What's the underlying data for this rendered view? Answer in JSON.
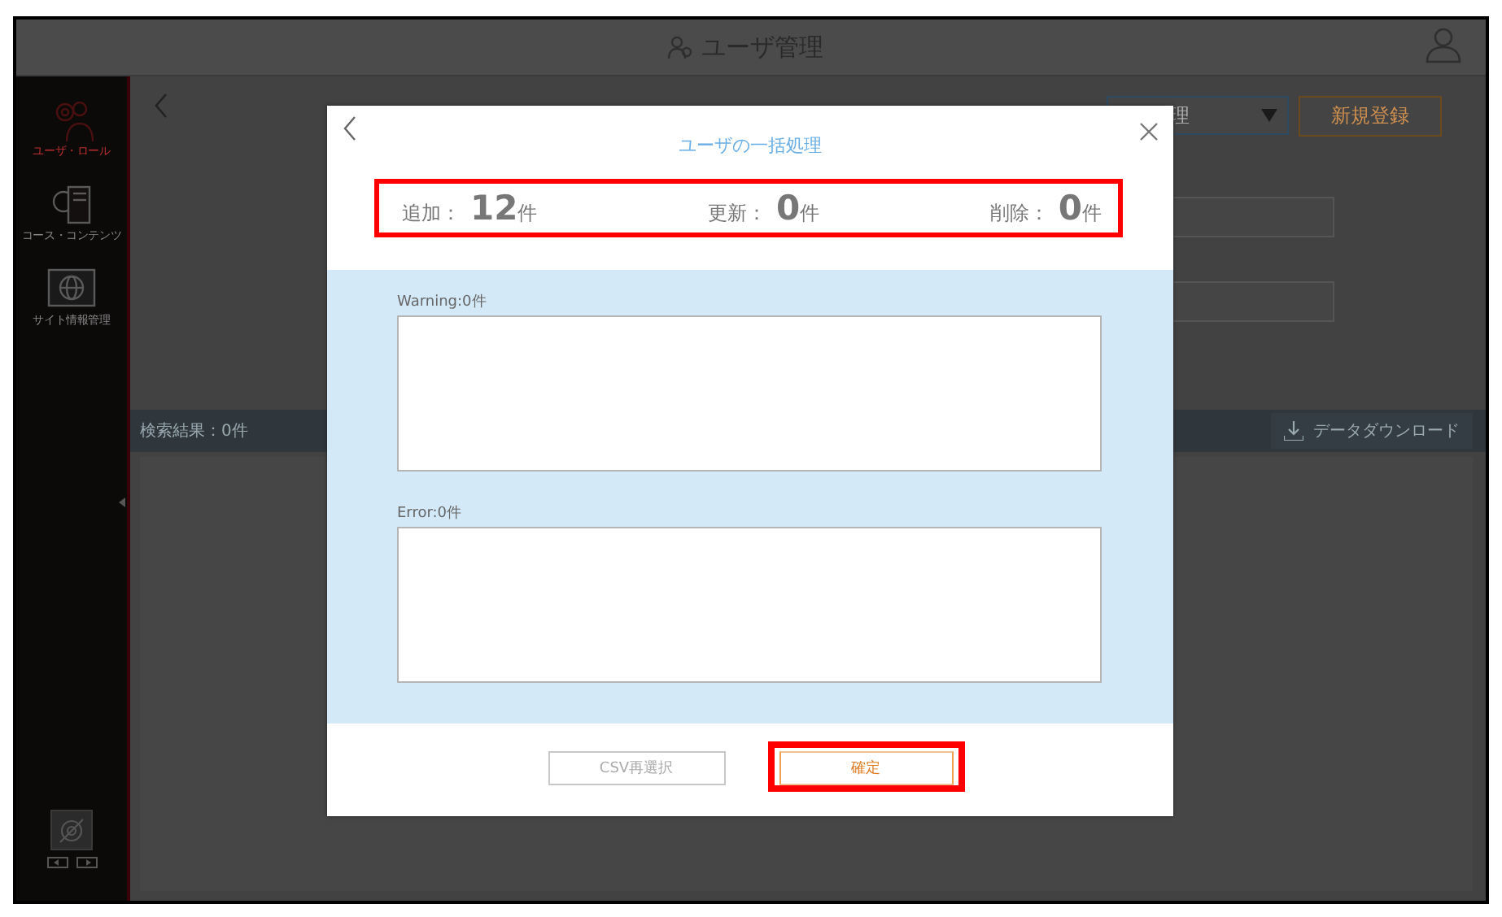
{
  "header": {
    "title": "ユーザ管理"
  },
  "sidebar": {
    "items": [
      {
        "label": "ユーザ・ロール",
        "selected": true
      },
      {
        "label": "コース・コンテンツ",
        "selected": false
      },
      {
        "label": "サイト情報管理",
        "selected": false
      }
    ]
  },
  "form": {
    "select_value": "理",
    "new_button": "新規登録"
  },
  "results": {
    "count": "検索結果：0件",
    "download_button": "データダウンロード"
  },
  "dialog": {
    "title": "ユーザの一括処理",
    "summary": {
      "highlighted": true,
      "items": [
        {
          "label": "追加：",
          "count": "12",
          "unit": "件"
        },
        {
          "label": "更新：",
          "count": "0",
          "unit": "件"
        },
        {
          "label": "削除：",
          "count": "0",
          "unit": "件"
        }
      ]
    },
    "logs": [
      {
        "label": "Warning:0件"
      },
      {
        "label": "Error:0件"
      }
    ],
    "buttons": [
      {
        "label": "CSV再選択",
        "kind": "secondary",
        "highlighted": false
      },
      {
        "label": "確定",
        "kind": "primary",
        "highlighted": true
      }
    ]
  }
}
